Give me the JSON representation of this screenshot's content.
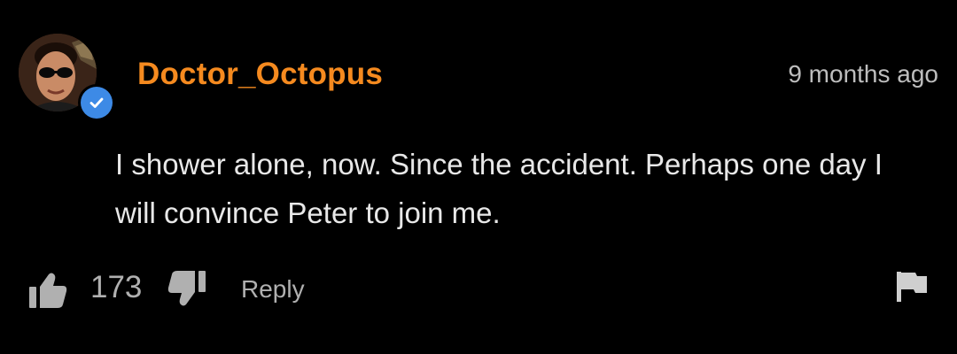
{
  "comment": {
    "username": "Doctor_Octopus",
    "timestamp": "9 months ago",
    "text": "I shower alone, now. Since the accident. Perhaps one day I will convince Peter to join me.",
    "verified": true,
    "avatar_icon": "user-avatar",
    "colors": {
      "username": "#f58a1f",
      "verified_badge": "#3d8ae6",
      "background": "#000000"
    }
  },
  "actions": {
    "like_count": "173",
    "reply_label": "Reply",
    "like_icon": "thumbs-up-icon",
    "dislike_icon": "thumbs-down-icon",
    "flag_icon": "flag-icon"
  }
}
